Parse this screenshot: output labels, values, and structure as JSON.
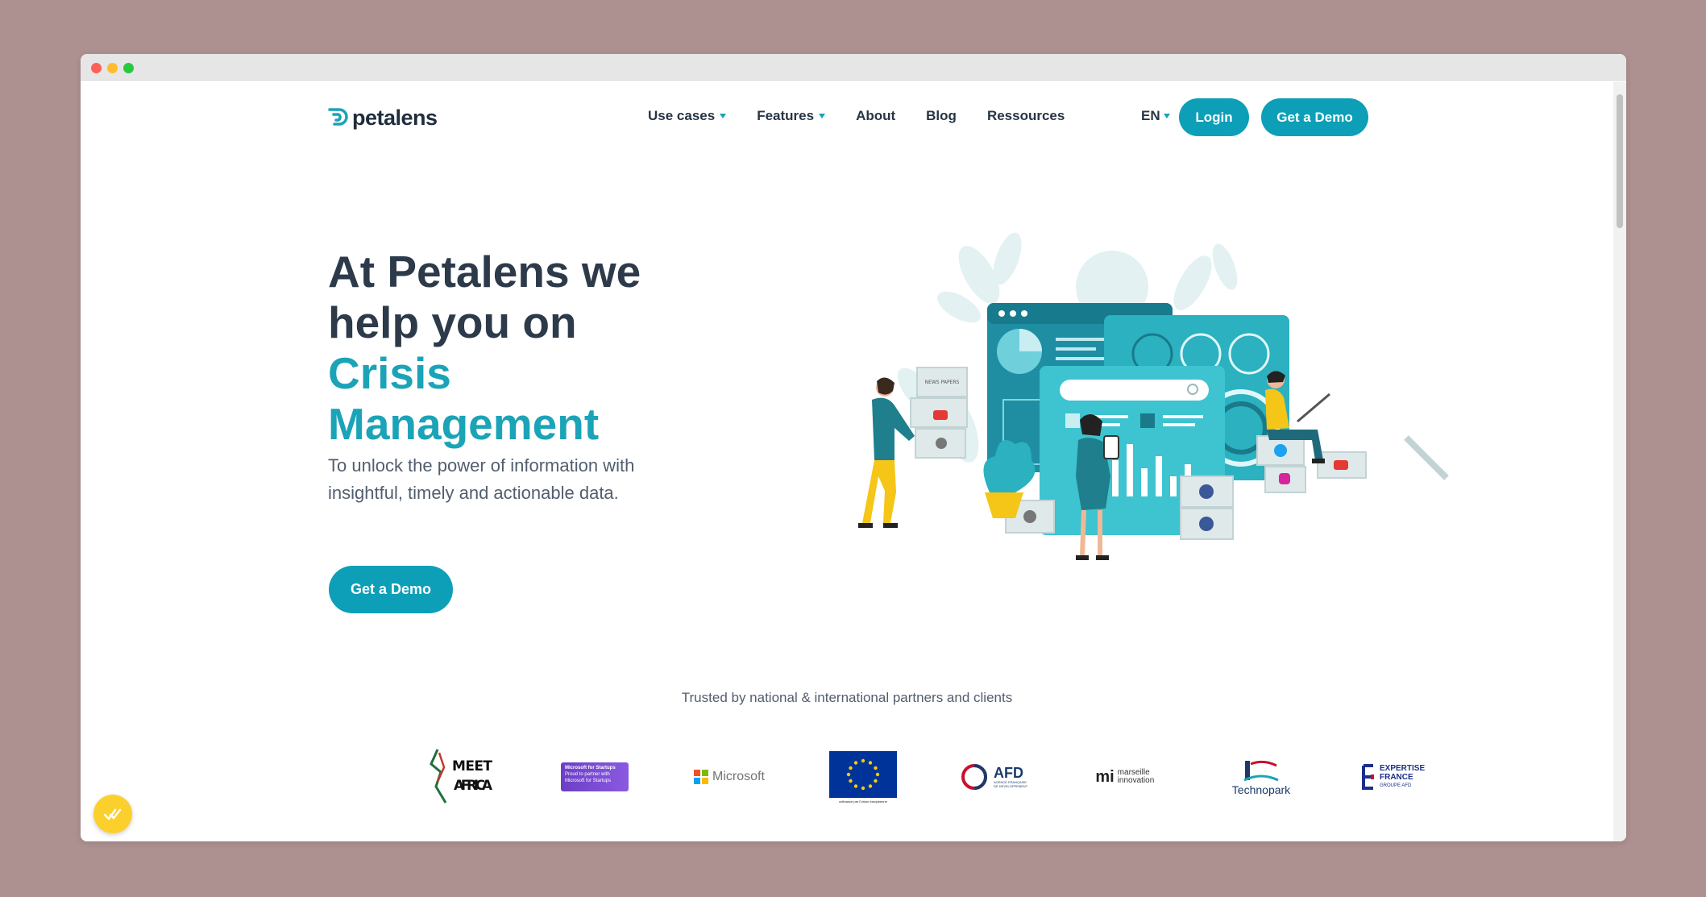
{
  "brand": {
    "name": "petalens"
  },
  "nav": {
    "items": [
      {
        "label": "Use cases",
        "dropdown": true
      },
      {
        "label": "Features",
        "dropdown": true
      },
      {
        "label": "About",
        "dropdown": false
      },
      {
        "label": "Blog",
        "dropdown": false
      },
      {
        "label": "Ressources",
        "dropdown": false
      }
    ],
    "language": "EN",
    "login_label": "Login",
    "demo_label": "Get a Demo"
  },
  "hero": {
    "title_line1": "At Petalens we help you on",
    "title_accent": "Crisis Management",
    "subtitle": "To unlock the power of information with insightful, timely and actionable data.",
    "cta_label": "Get a Demo"
  },
  "illustration": {
    "box_labels": [
      "NEWS PAPERS"
    ]
  },
  "partners": {
    "heading": "Trusted by national & international partners and clients",
    "items": [
      {
        "name": "MEET AFRICA"
      },
      {
        "name": "Microsoft for Startups",
        "small": "Proud to partner with Microsoft for Startups"
      },
      {
        "name": "Microsoft"
      },
      {
        "name": "European Union",
        "small": "cofinancé par l'Union européenne"
      },
      {
        "name": "AFD",
        "small": "AGENCE FRANÇAISE DE DÉVELOPPEMENT"
      },
      {
        "name": "marseille innovation"
      },
      {
        "name": "Technopark"
      },
      {
        "name": "EXPERTISE FRANCE",
        "small": "GROUPE AFD"
      }
    ]
  },
  "colors": {
    "accent": "#1ba3b7",
    "button": "#0d9fb7",
    "heading": "#2c3a4a",
    "background": "#ad9190"
  }
}
